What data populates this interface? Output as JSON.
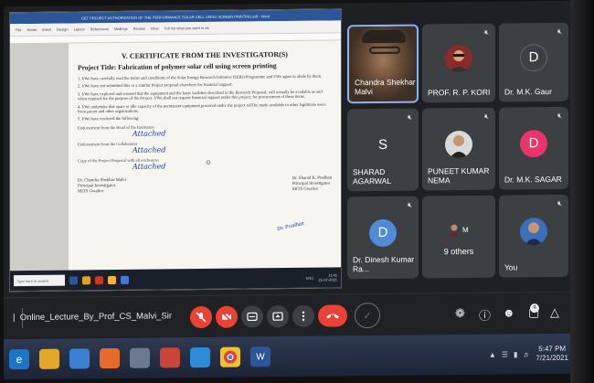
{
  "document": {
    "titlebar": "GET PROJECT AUTHORIZATION OF THE PERFORMANCE SOLAR CELL USING SCREEN PRINTING.pdf - Word",
    "ribbon": [
      "File",
      "Home",
      "Insert",
      "Design",
      "Layout",
      "References",
      "Mailings",
      "Review",
      "View",
      "Tell me what you want to do"
    ],
    "heading": "V.    CERTIFICATE FROM THE INVESTIGATOR(S)",
    "project_title": "Project Title: Fabrication of polymer solar cell using screen printing",
    "paragraphs": [
      "1.  I/We have carefully read the terms and conditions of the Solar Energy Research Initiative (SERI) Programme and I/We agree to abide by them.",
      "2.  I/We have not submitted this or a similar Project proposal elsewhere for financial support.",
      "3.  I/We have explored and ensured that the equipment and the basic facilities described in the Research Proposal, will actually be available as and when required for the purpose of the Project. I/We shall not request financial support under this project, for procurement of these items.",
      "4.  I/We undertake that spare or idle capacity of the permanent equipment procured under the project will be made available to other legitimate users from parent and other organizations.",
      "5.  I/We have enclosed the following:"
    ],
    "signature_labels": [
      "Endorsement from the Head of the Institution",
      "Endorsement from the Collaborator",
      "Copy of the Project Proposal with all enclosures"
    ],
    "signature_text": "Attached",
    "investigator_1": {
      "name": "Dr. Chandra Shekhar Malvi",
      "role": "Principal Investigator",
      "org": "MITS Gwalior"
    },
    "investigator_2": {
      "name": "Dr. Sharad K. Pradhan",
      "role": "Principal Investigator",
      "org": "MITS Gwalior"
    },
    "stamp": "Dr. Pradhan",
    "search_placeholder": "Type here to search",
    "status": "ENG",
    "clock_time": "11:41",
    "clock_date": "21-07-2021"
  },
  "participants": [
    {
      "name": "Chandra Shekhar Malvi",
      "type": "video"
    },
    {
      "name": "PROF. R. P. KORI",
      "type": "photo",
      "color": "#8a2a2a"
    },
    {
      "name": "Dr. M.K. Gaur",
      "type": "letter",
      "letter": "D",
      "color": "#3c4043"
    },
    {
      "name": "SHARAD AGARWAL",
      "type": "letter",
      "letter": "S",
      "color": "#3c4043"
    },
    {
      "name": "PUNEET KUMAR NEMA",
      "type": "photo",
      "color": "#d9d9d9"
    },
    {
      "name": "Dr. M.K. SAGAR",
      "type": "letter",
      "letter": "D",
      "color": "#e8336d"
    },
    {
      "name": "Dr. Dinesh Kumar Ra...",
      "type": "letter",
      "letter": "D",
      "color": "#4f8bd6"
    },
    {
      "name": "9 others",
      "type": "others",
      "letter": "M"
    },
    {
      "name": "You",
      "type": "photo",
      "color": "#3a70b8"
    }
  ],
  "meeting": {
    "title": "Online_Lecture_By_Prof_CS_Malvi_Sir",
    "controls": [
      "mic-off",
      "camera-off",
      "captions",
      "present",
      "more",
      "leave",
      "check"
    ],
    "people_count": "9"
  },
  "taskbar": {
    "apps": [
      "edge",
      "file-explorer",
      "media",
      "firefox",
      "files",
      "java",
      "photos",
      "chrome",
      "word"
    ],
    "clock_time": "5:47 PM",
    "clock_date": "7/21/2021"
  },
  "colors": {
    "accent": "#8ab4f8",
    "leave": "#ea4335",
    "meet_bg": "#202124",
    "tile": "#3c4043"
  }
}
